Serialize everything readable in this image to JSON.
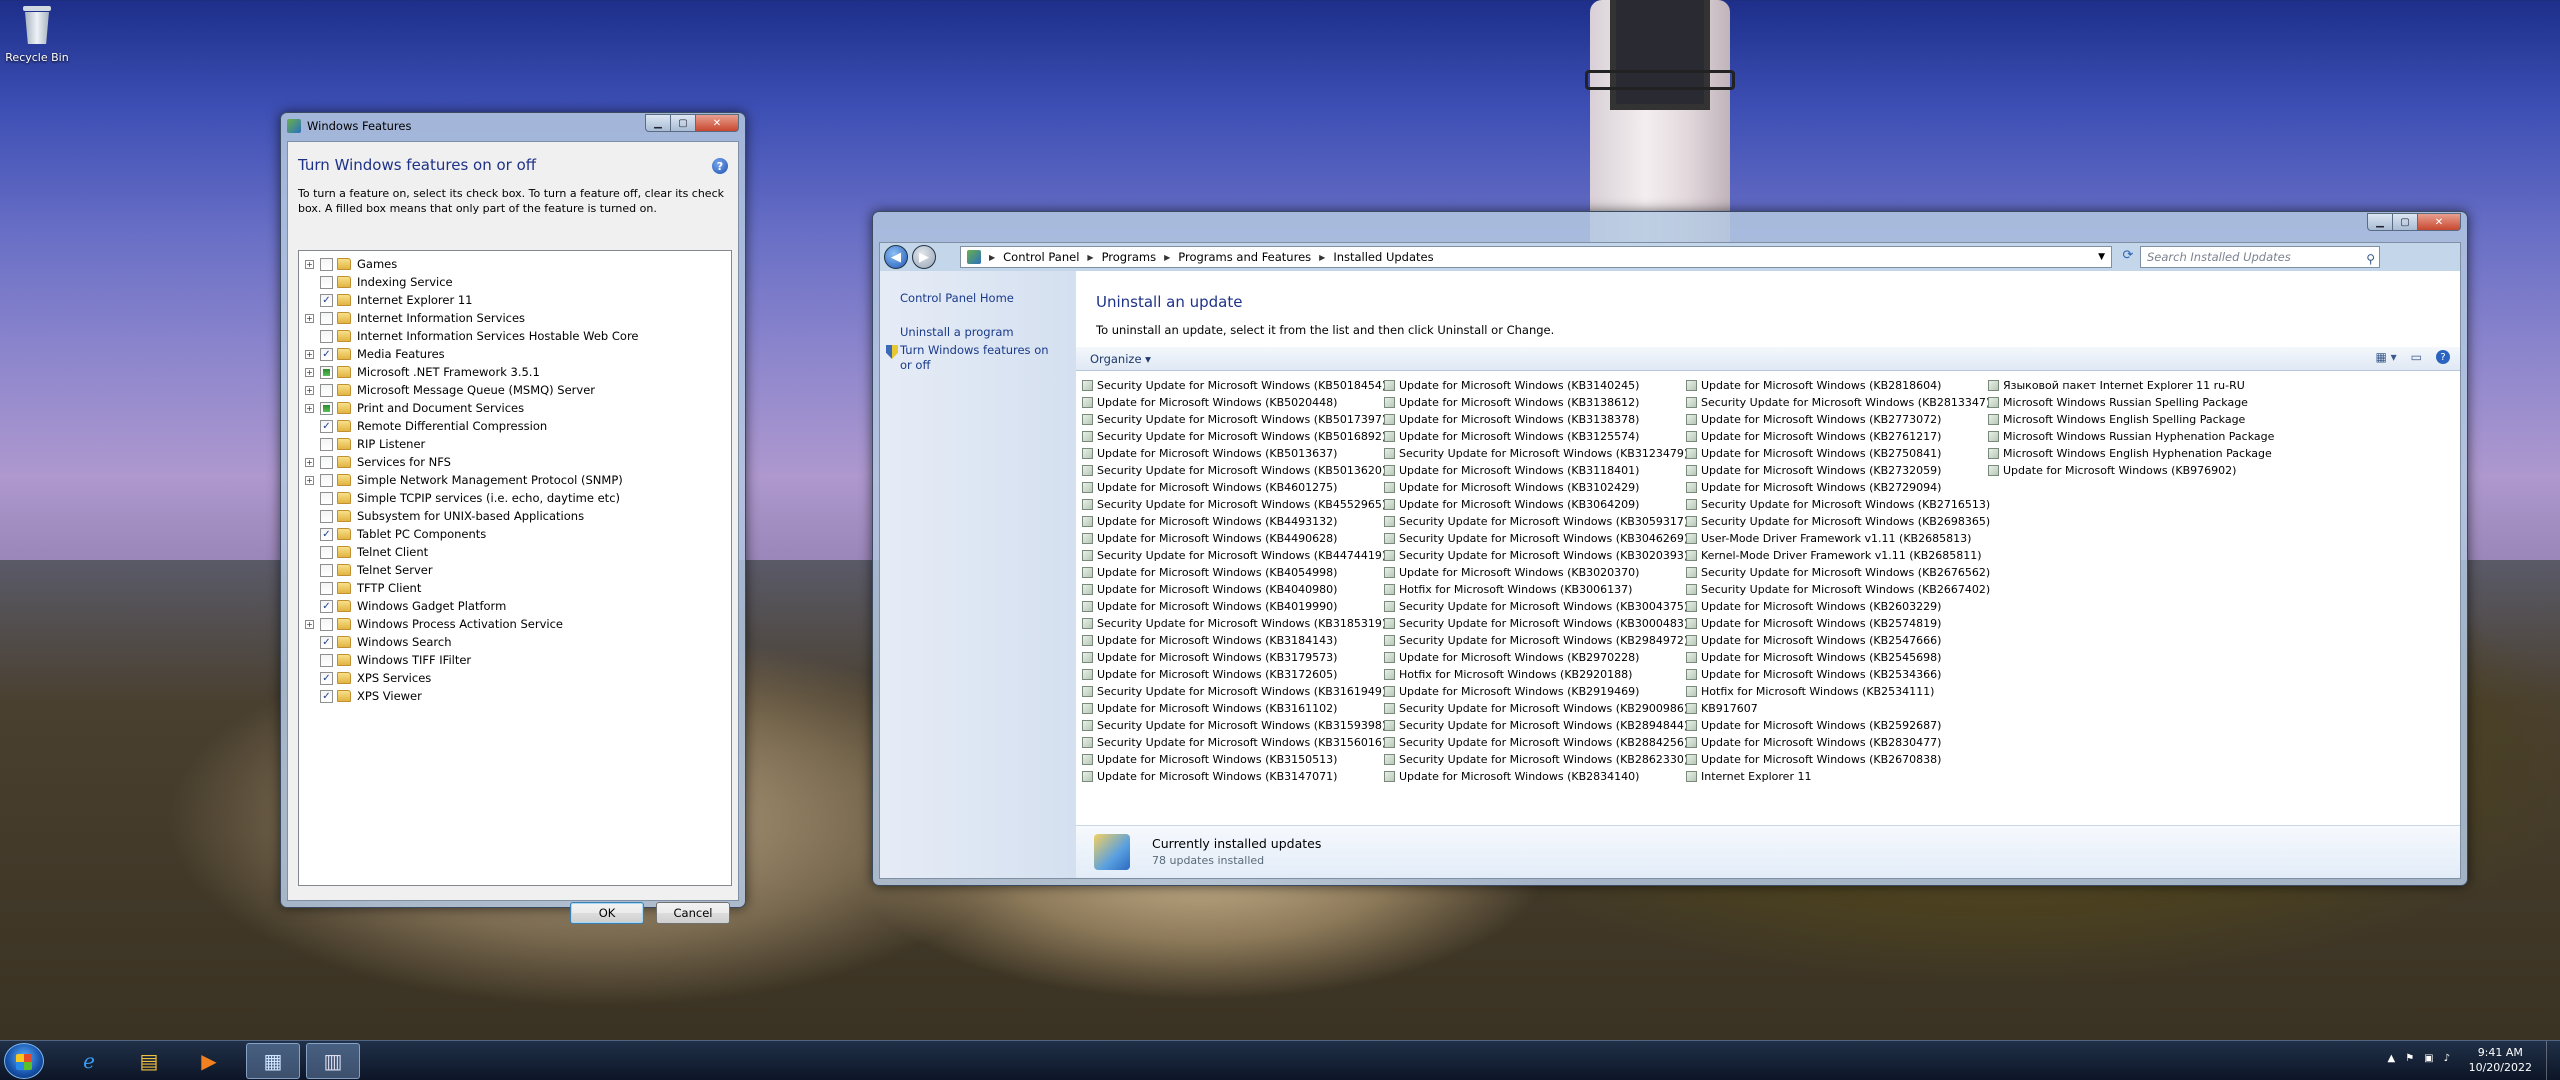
{
  "desktop": {
    "recycle_bin": "Recycle Bin"
  },
  "features_window": {
    "title": "Windows Features",
    "heading": "Turn Windows features on or off",
    "description": "To turn a feature on, select its check box. To turn a feature off, clear its check box. A filled box means that only part of the feature is turned on.",
    "items": [
      {
        "label": "Games",
        "expand": true,
        "state": "off"
      },
      {
        "label": "Indexing Service",
        "expand": false,
        "state": "off"
      },
      {
        "label": "Internet Explorer 11",
        "expand": false,
        "state": "on"
      },
      {
        "label": "Internet Information Services",
        "expand": true,
        "state": "off"
      },
      {
        "label": "Internet Information Services Hostable Web Core",
        "expand": false,
        "state": "off"
      },
      {
        "label": "Media Features",
        "expand": true,
        "state": "on"
      },
      {
        "label": "Microsoft .NET Framework 3.5.1",
        "expand": true,
        "state": "partial"
      },
      {
        "label": "Microsoft Message Queue (MSMQ) Server",
        "expand": true,
        "state": "off"
      },
      {
        "label": "Print and Document Services",
        "expand": true,
        "state": "partial"
      },
      {
        "label": "Remote Differential Compression",
        "expand": false,
        "state": "on"
      },
      {
        "label": "RIP Listener",
        "expand": false,
        "state": "off"
      },
      {
        "label": "Services for NFS",
        "expand": true,
        "state": "off"
      },
      {
        "label": "Simple Network Management Protocol (SNMP)",
        "expand": true,
        "state": "off"
      },
      {
        "label": "Simple TCPIP services (i.e. echo, daytime etc)",
        "expand": false,
        "state": "off"
      },
      {
        "label": "Subsystem for UNIX-based Applications",
        "expand": false,
        "state": "off"
      },
      {
        "label": "Tablet PC Components",
        "expand": false,
        "state": "on"
      },
      {
        "label": "Telnet Client",
        "expand": false,
        "state": "off"
      },
      {
        "label": "Telnet Server",
        "expand": false,
        "state": "off"
      },
      {
        "label": "TFTP Client",
        "expand": false,
        "state": "off"
      },
      {
        "label": "Windows Gadget Platform",
        "expand": false,
        "state": "on"
      },
      {
        "label": "Windows Process Activation Service",
        "expand": true,
        "state": "off"
      },
      {
        "label": "Windows Search",
        "expand": false,
        "state": "on"
      },
      {
        "label": "Windows TIFF IFilter",
        "expand": false,
        "state": "off"
      },
      {
        "label": "XPS Services",
        "expand": false,
        "state": "on"
      },
      {
        "label": "XPS Viewer",
        "expand": false,
        "state": "on"
      }
    ],
    "ok": "OK",
    "cancel": "Cancel"
  },
  "updates_window": {
    "breadcrumb": [
      "Control Panel",
      "Programs",
      "Programs and Features",
      "Installed Updates"
    ],
    "search_placeholder": "Search Installed Updates",
    "left_links": {
      "home": "Control Panel Home",
      "uninstall": "Uninstall a program",
      "features": "Turn Windows features on or off"
    },
    "title": "Uninstall an update",
    "description": "To uninstall an update, select it from the list and then click Uninstall or Change.",
    "organize": "Organize",
    "columns": [
      [
        "Security Update for Microsoft Windows (KB5018454)",
        "Update for Microsoft Windows (KB5020448)",
        "Security Update for Microsoft Windows (KB5017397)",
        "Security Update for Microsoft Windows (KB5016892)",
        "Update for Microsoft Windows (KB5013637)",
        "Security Update for Microsoft Windows (KB5013620)",
        "Update for Microsoft Windows (KB4601275)",
        "Security Update for Microsoft Windows (KB4552965)",
        "Update for Microsoft Windows (KB4493132)",
        "Update for Microsoft Windows (KB4490628)",
        "Security Update for Microsoft Windows (KB4474419)",
        "Update for Microsoft Windows (KB4054998)",
        "Update for Microsoft Windows (KB4040980)",
        "Update for Microsoft Windows (KB4019990)",
        "Security Update for Microsoft Windows (KB3185319)",
        "Update for Microsoft Windows (KB3184143)",
        "Update for Microsoft Windows (KB3179573)",
        "Update for Microsoft Windows (KB3172605)",
        "Security Update for Microsoft Windows (KB3161949)",
        "Update for Microsoft Windows (KB3161102)",
        "Security Update for Microsoft Windows (KB3159398)",
        "Security Update for Microsoft Windows (KB3156016)",
        "Update for Microsoft Windows (KB3150513)",
        "Update for Microsoft Windows (KB3147071)"
      ],
      [
        "Update for Microsoft Windows (KB3140245)",
        "Update for Microsoft Windows (KB3138612)",
        "Update for Microsoft Windows (KB3138378)",
        "Update for Microsoft Windows (KB3125574)",
        "Security Update for Microsoft Windows (KB3123479)",
        "Update for Microsoft Windows (KB3118401)",
        "Update for Microsoft Windows (KB3102429)",
        "Update for Microsoft Windows (KB3064209)",
        "Security Update for Microsoft Windows (KB3059317)",
        "Security Update for Microsoft Windows (KB3046269)",
        "Security Update for Microsoft Windows (KB3020393)",
        "Update for Microsoft Windows (KB3020370)",
        "Hotfix for Microsoft Windows (KB3006137)",
        "Security Update for Microsoft Windows (KB3004375)",
        "Security Update for Microsoft Windows (KB3000483)",
        "Security Update for Microsoft Windows (KB2984972)",
        "Update for Microsoft Windows (KB2970228)",
        "Hotfix for Microsoft Windows (KB2920188)",
        "Update for Microsoft Windows (KB2919469)",
        "Security Update for Microsoft Windows (KB2900986)",
        "Security Update for Microsoft Windows (KB2894844)",
        "Security Update for Microsoft Windows (KB2884256)",
        "Security Update for Microsoft Windows (KB2862330)",
        "Update for Microsoft Windows (KB2834140)"
      ],
      [
        "Update for Microsoft Windows (KB2818604)",
        "Security Update for Microsoft Windows (KB2813347)",
        "Update for Microsoft Windows (KB2773072)",
        "Update for Microsoft Windows (KB2761217)",
        "Update for Microsoft Windows (KB2750841)",
        "Update for Microsoft Windows (KB2732059)",
        "Update for Microsoft Windows (KB2729094)",
        "Security Update for Microsoft Windows (KB2716513)",
        "Security Update for Microsoft Windows (KB2698365)",
        "User-Mode Driver Framework v1.11 (KB2685813)",
        "Kernel-Mode Driver Framework v1.11 (KB2685811)",
        "Security Update for Microsoft Windows (KB2676562)",
        "Security Update for Microsoft Windows (KB2667402)",
        "Update for Microsoft Windows (KB2603229)",
        "Update for Microsoft Windows (KB2574819)",
        "Update for Microsoft Windows (KB2547666)",
        "Update for Microsoft Windows (KB2545698)",
        "Update for Microsoft Windows (KB2534366)",
        "Hotfix for Microsoft Windows (KB2534111)",
        "KB917607",
        "Update for Microsoft Windows (KB2592687)",
        "Update for Microsoft Windows (KB2830477)",
        "Update for Microsoft Windows (KB2670838)",
        "Internet Explorer 11"
      ],
      [
        "Языковой пакет Internet Explorer 11 ru-RU",
        "Microsoft Windows Russian Spelling Package",
        "Microsoft Windows English Spelling Package",
        "Microsoft Windows Russian Hyphenation Package",
        "Microsoft Windows English Hyphenation Package",
        "Update for Microsoft Windows (KB976902)"
      ]
    ],
    "details_title": "Currently installed updates",
    "details_count": "78 updates installed"
  },
  "taskbar": {
    "time": "9:41 AM",
    "date": "10/20/2022"
  }
}
